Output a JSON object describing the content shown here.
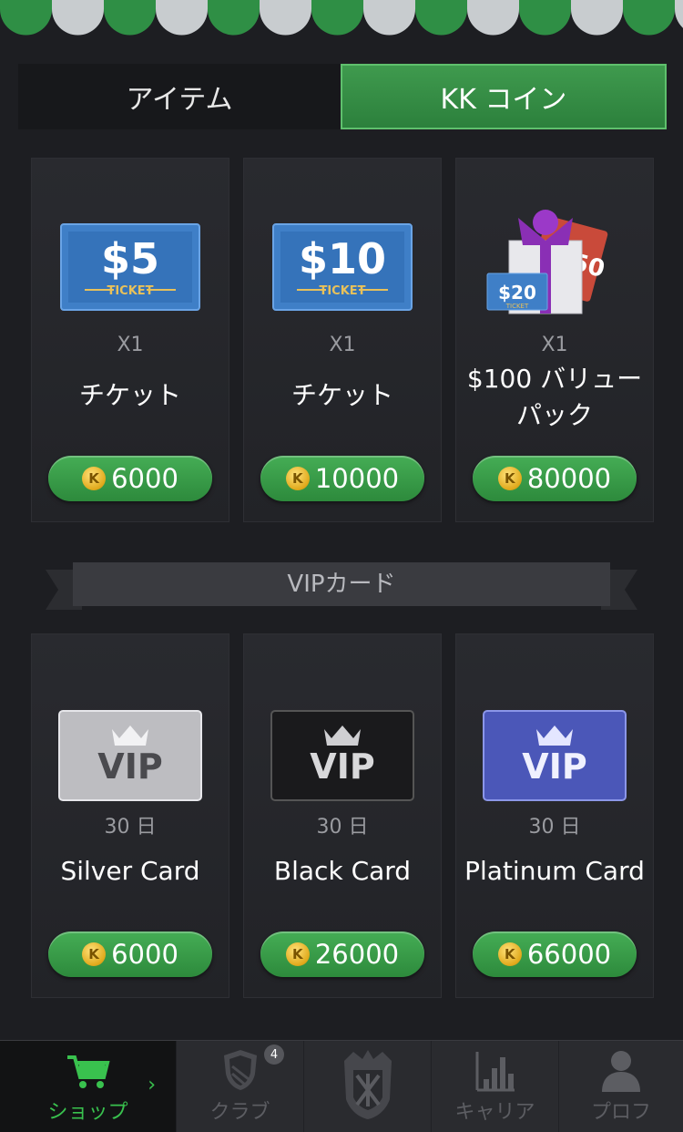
{
  "tabs": [
    {
      "label": "アイテム",
      "active": false
    },
    {
      "label": "KK コイン",
      "active": true
    }
  ],
  "coin_symbol": "K",
  "items": [
    {
      "ticket_value": "$5",
      "ticket_label": "TICKET",
      "qty": "X1",
      "name": "チケット",
      "price": "6000"
    },
    {
      "ticket_value": "$10",
      "ticket_label": "TICKET",
      "qty": "X1",
      "name": "チケット",
      "price": "10000"
    },
    {
      "ticket_value": "$20",
      "ticket_label": "TICKET",
      "qty": "X1",
      "name": "$100 バリュー パック",
      "price": "80000"
    }
  ],
  "vip_section_title": "VIPカード",
  "vip_cards": [
    {
      "label": "VIP",
      "duration": "30 日",
      "name": "Silver Card",
      "price": "6000",
      "color": "#c9c9c9"
    },
    {
      "label": "VIP",
      "duration": "30 日",
      "name": "Black Card",
      "price": "26000",
      "color": "#2a2a2a"
    },
    {
      "label": "VIP",
      "duration": "30 日",
      "name": "Platinum Card",
      "price": "66000",
      "color": "#4b57b8"
    }
  ],
  "nav": [
    {
      "label": "ショップ",
      "icon": "cart-icon",
      "active": true
    },
    {
      "label": "クラブ",
      "icon": "shield-icon",
      "badge": "4"
    },
    {
      "label": "",
      "icon": "kk-logo-icon"
    },
    {
      "label": "キャリア",
      "icon": "bar-chart-icon"
    },
    {
      "label": "プロフ",
      "icon": "profile-icon"
    }
  ],
  "colors": {
    "accent": "#39c14e",
    "background": "#1d1e22",
    "card": "#26272b"
  }
}
